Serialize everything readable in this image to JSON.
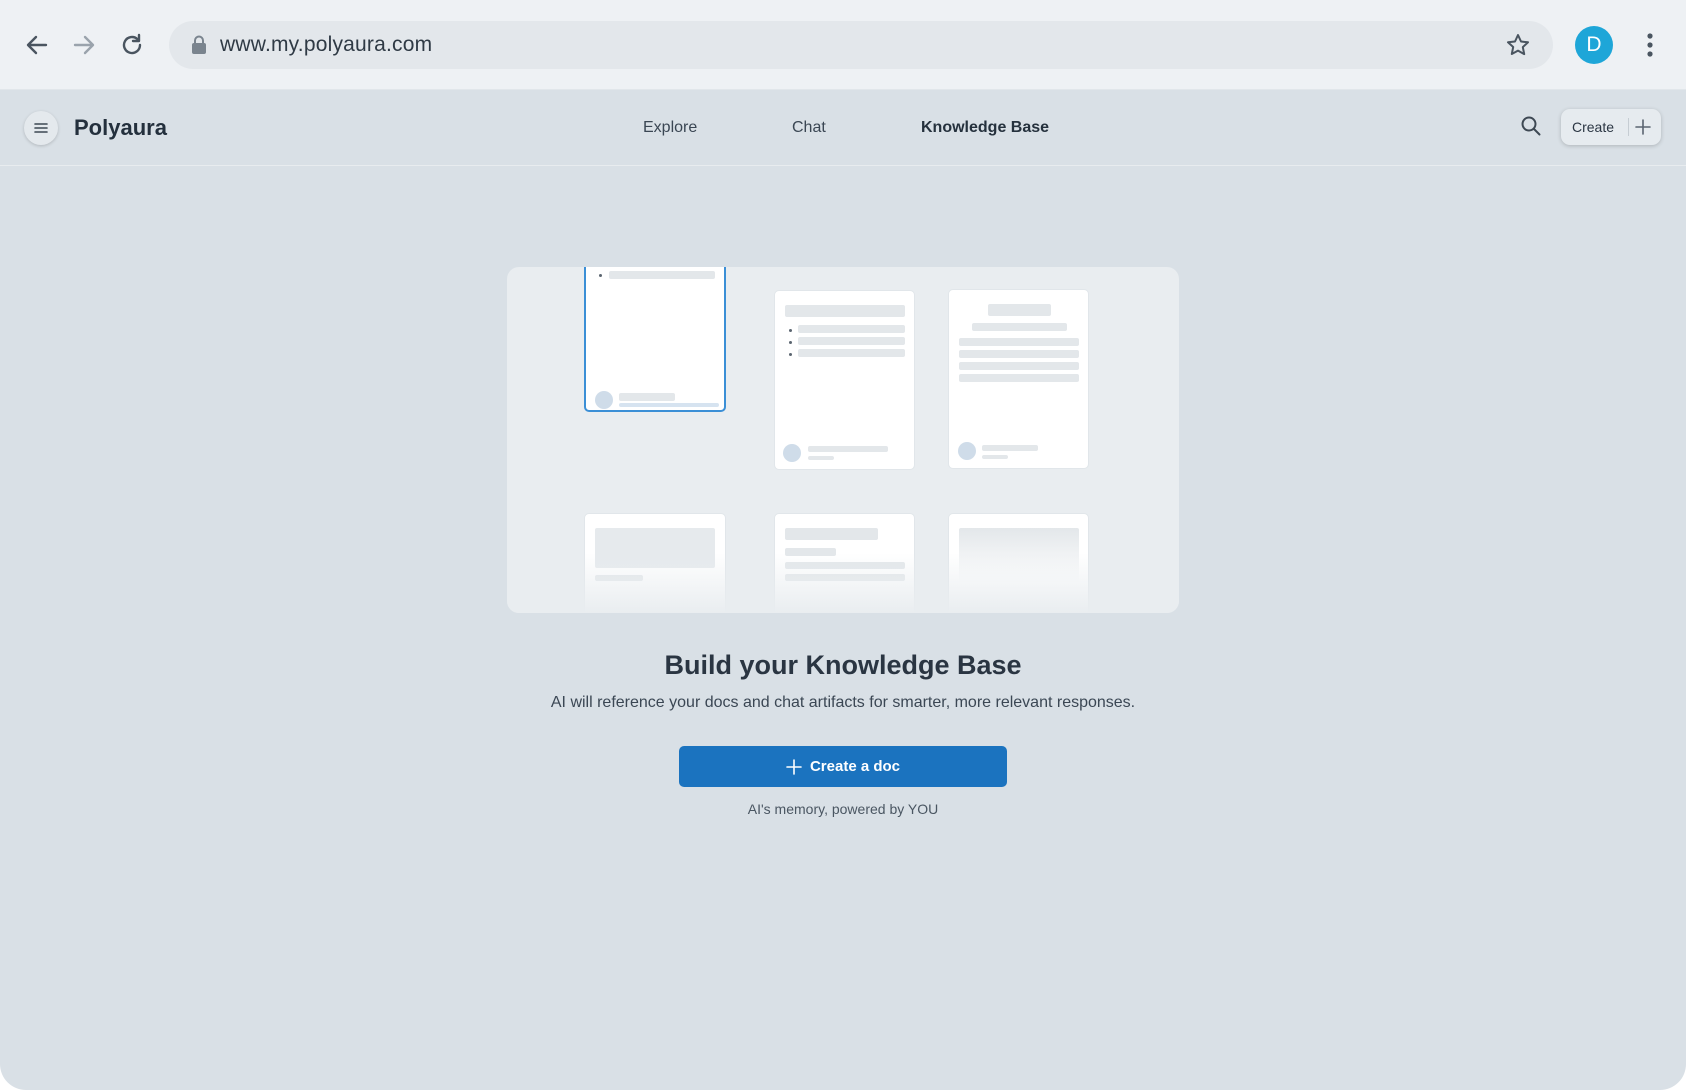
{
  "browser": {
    "url": "www.my.polyaura.com",
    "profile_initial": "D",
    "icons": [
      "back-arrow-icon",
      "forward-arrow-icon",
      "reload-icon",
      "lock-icon",
      "bookmark-star-icon",
      "kebab-menu-icon"
    ]
  },
  "app": {
    "title": "Polyaura",
    "tabs": [
      {
        "label": "Explore",
        "active": false
      },
      {
        "label": "Chat",
        "active": false
      },
      {
        "label": "Knowledge Base",
        "active": true
      }
    ],
    "create_label": "Create"
  },
  "main": {
    "headline": "Build your Knowledge Base",
    "subline": "AI will reference your docs and chat artifacts for smarter, more relevant responses.",
    "cta_label": "Create a doc",
    "tagline": "AI's memory, powered by YOU"
  },
  "colors": {
    "accent": "#1b73bf",
    "avatar": "#1ea6d8",
    "background": "#d9e0e6"
  }
}
